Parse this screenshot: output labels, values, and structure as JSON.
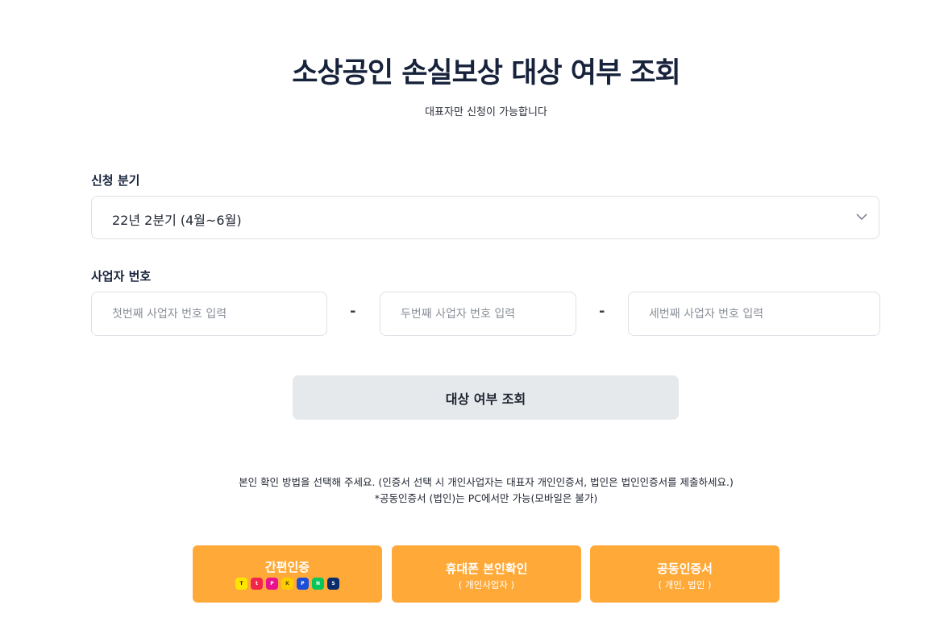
{
  "header": {
    "title": "소상공인 손실보상 대상 여부 조회",
    "subtitle": "대표자만 신청이 가능합니다"
  },
  "quarter": {
    "label": "신청 분기",
    "selected": "22년 2분기 (4월~6월)"
  },
  "business_number": {
    "label": "사업자 번호",
    "placeholders": [
      "첫번째 사업자 번호 입력",
      "두번째 사업자 번호 입력",
      "세번째 사업자 번호 입력"
    ],
    "separator": "-"
  },
  "lookup_button": {
    "label": "대상 여부 조회"
  },
  "notice": {
    "line1": "본인 확인 방법을 선택해 주세요. (인증서 선택 시 개인사업자는 대표자 개인인증서, 법인은 법인인증서를 제출하세요.)",
    "line2": "*공동인증서 (법인)는 PC에서만 가능(모바일은 불가)"
  },
  "auth_buttons": [
    {
      "title": "간편인증",
      "providers": [
        {
          "icon": "kakao-icon",
          "bg": "#fee500",
          "fg": "#3a1d1d"
        },
        {
          "icon": "toss-icon",
          "bg": "#f2264b",
          "fg": "#ffffff"
        },
        {
          "icon": "pass-icon",
          "bg": "#e8118e",
          "fg": "#ffffff"
        },
        {
          "icon": "kb-icon",
          "bg": "#ffcc00",
          "fg": "#5a4a00"
        },
        {
          "icon": "samsung-pass-icon",
          "bg": "#1c4fd8",
          "fg": "#ffffff"
        },
        {
          "icon": "naver-icon",
          "bg": "#03c75a",
          "fg": "#ffffff"
        },
        {
          "icon": "shinhan-icon",
          "bg": "#0b2d6b",
          "fg": "#ffffff"
        }
      ]
    },
    {
      "title": "휴대폰 본인확인",
      "subtitle": "( 개인사업자 )"
    },
    {
      "title": "공동인증서",
      "subtitle": "( 개인, 법인 )"
    }
  ],
  "colors": {
    "accent": "#ffa938",
    "title": "#17223b",
    "lookup_bg": "#e6e9ec",
    "border": "#dde1e6"
  }
}
